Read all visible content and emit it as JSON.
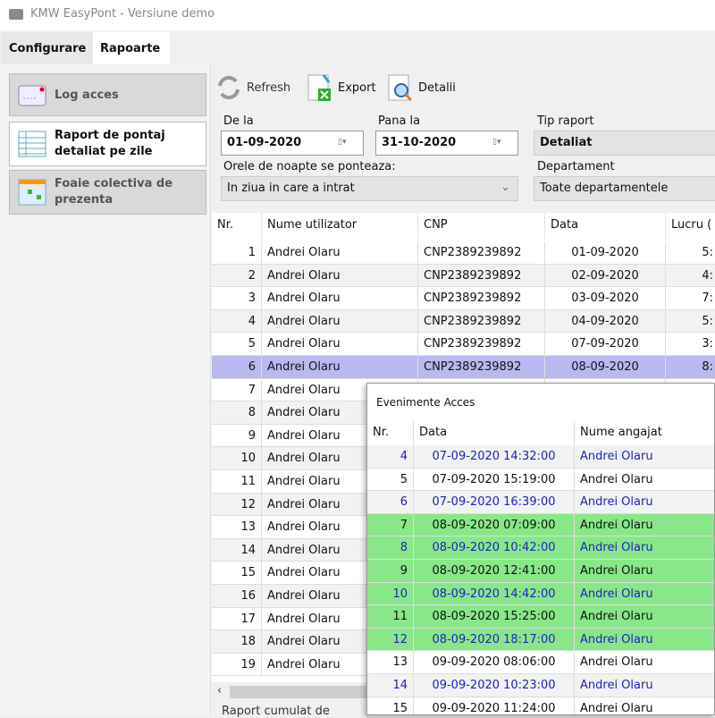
{
  "window": {
    "title": "KMW EasyPont - Versiune demo"
  },
  "tabs": [
    {
      "label": "Configurare"
    },
    {
      "label": "Rapoarte",
      "active": true
    }
  ],
  "sidebar": {
    "items": [
      {
        "label": "Log acces",
        "icon": "log-icon"
      },
      {
        "label": "Raport de pontaj detaliat pe zile",
        "icon": "table-icon",
        "active": true
      },
      {
        "label": "Foaie colectiva de prezenta",
        "icon": "calendar-icon"
      }
    ]
  },
  "toolbar": {
    "refresh": "Refresh",
    "export": "Export",
    "details": "Detalii"
  },
  "filters": {
    "from_label": "De la",
    "from_value": "01-09-2020",
    "to_label": "Pana la",
    "to_value": "31-10-2020",
    "type_label": "Tip raport",
    "type_value": "Detaliat",
    "night_label": "Orele de noapte se ponteaza:",
    "night_value": "In ziua in care a intrat",
    "dept_label": "Departament",
    "dept_value": "Toate departamentele"
  },
  "grid": {
    "columns": [
      "Nr.",
      "Nume utilizator",
      "CNP",
      "Data",
      "Lucru ("
    ],
    "rows": [
      [
        "1",
        "Andrei Olaru",
        "CNP2389239892",
        "01-09-2020",
        "5:"
      ],
      [
        "2",
        "Andrei Olaru",
        "CNP2389239892",
        "02-09-2020",
        "4:"
      ],
      [
        "3",
        "Andrei Olaru",
        "CNP2389239892",
        "03-09-2020",
        "7:"
      ],
      [
        "4",
        "Andrei Olaru",
        "CNP2389239892",
        "04-09-2020",
        "5:"
      ],
      [
        "5",
        "Andrei Olaru",
        "CNP2389239892",
        "07-09-2020",
        "3:"
      ],
      [
        "6",
        "Andrei Olaru",
        "CNP2389239892",
        "08-09-2020",
        "8:"
      ],
      [
        "7",
        "Andrei Olaru",
        "",
        "",
        ""
      ],
      [
        "8",
        "Andrei Olaru",
        "",
        "",
        ""
      ],
      [
        "9",
        "Andrei Olaru",
        "",
        "",
        ""
      ],
      [
        "10",
        "Andrei Olaru",
        "",
        "",
        ""
      ],
      [
        "11",
        "Andrei Olaru",
        "",
        "",
        ""
      ],
      [
        "12",
        "Andrei Olaru",
        "",
        "",
        ""
      ],
      [
        "13",
        "Andrei Olaru",
        "",
        "",
        ""
      ],
      [
        "14",
        "Andrei Olaru",
        "",
        "",
        ""
      ],
      [
        "15",
        "Andrei Olaru",
        "",
        "",
        ""
      ],
      [
        "16",
        "Andrei Olaru",
        "",
        "",
        ""
      ],
      [
        "17",
        "Andrei Olaru",
        "",
        "",
        ""
      ],
      [
        "18",
        "Andrei Olaru",
        "",
        "",
        ""
      ],
      [
        "19",
        "Andrei Olaru",
        "",
        "",
        ""
      ]
    ],
    "selected_row": 6
  },
  "status": "Raport cumulat de",
  "popup": {
    "title": "Evenimente Acces",
    "columns": [
      "Nr.",
      "Data",
      "Nume angajat"
    ],
    "rows": [
      {
        "nr": "4",
        "date": "07-09-2020 14:32:00",
        "name": "Andrei Olaru",
        "blue": true,
        "green": false
      },
      {
        "nr": "5",
        "date": "07-09-2020 15:19:00",
        "name": "Andrei Olaru",
        "blue": false,
        "green": false
      },
      {
        "nr": "6",
        "date": "07-09-2020 16:39:00",
        "name": "Andrei Olaru",
        "blue": true,
        "green": false
      },
      {
        "nr": "7",
        "date": "08-09-2020 07:09:00",
        "name": "Andrei Olaru",
        "blue": false,
        "green": true
      },
      {
        "nr": "8",
        "date": "08-09-2020 10:42:00",
        "name": "Andrei Olaru",
        "blue": true,
        "green": true
      },
      {
        "nr": "9",
        "date": "08-09-2020 12:41:00",
        "name": "Andrei Olaru",
        "blue": false,
        "green": true
      },
      {
        "nr": "10",
        "date": "08-09-2020 14:42:00",
        "name": "Andrei Olaru",
        "blue": true,
        "green": true
      },
      {
        "nr": "11",
        "date": "08-09-2020 15:25:00",
        "name": "Andrei Olaru",
        "blue": false,
        "green": true
      },
      {
        "nr": "12",
        "date": "08-09-2020 18:17:00",
        "name": "Andrei Olaru",
        "blue": true,
        "green": true
      },
      {
        "nr": "13",
        "date": "09-09-2020 08:06:00",
        "name": "Andrei Olaru",
        "blue": false,
        "green": false
      },
      {
        "nr": "14",
        "date": "09-09-2020 10:23:00",
        "name": "Andrei Olaru",
        "blue": true,
        "green": false
      },
      {
        "nr": "15",
        "date": "09-09-2020 11:24:00",
        "name": "Andrei Olaru",
        "blue": false,
        "green": false
      }
    ]
  },
  "colors": {
    "selected": "#b9b9f0",
    "highlight": "#88e888",
    "link_blue": "#2020c0"
  }
}
